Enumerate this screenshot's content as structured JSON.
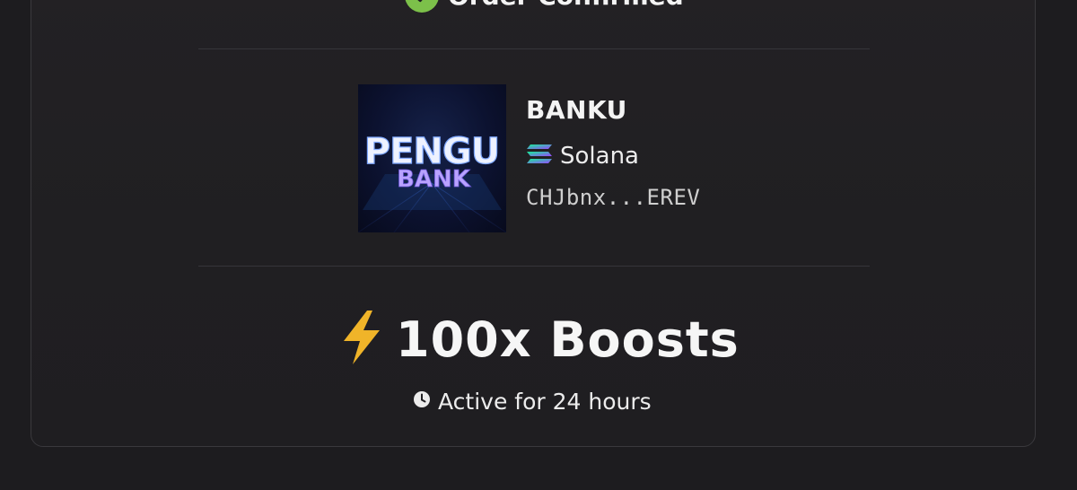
{
  "order": {
    "status_label": "Order Confirmed"
  },
  "token": {
    "image_line1": "PENGU",
    "image_line2": "BANK",
    "name": "BANKU",
    "chain": "Solana",
    "chain_icon": "solana-icon",
    "address": "CHJbnx...EREV"
  },
  "boost": {
    "icon": "lightning-bolt-icon",
    "label": "100x Boosts",
    "duration_icon": "clock-icon",
    "duration_label": "Active for 24 hours"
  },
  "colors": {
    "page_background": "#1d1c1f",
    "card_border": "#3a393d",
    "check_green": "#7cc04a",
    "bolt_yellow": "#f0b429",
    "solana_purple": "#9945ff",
    "solana_teal": "#14f195"
  }
}
